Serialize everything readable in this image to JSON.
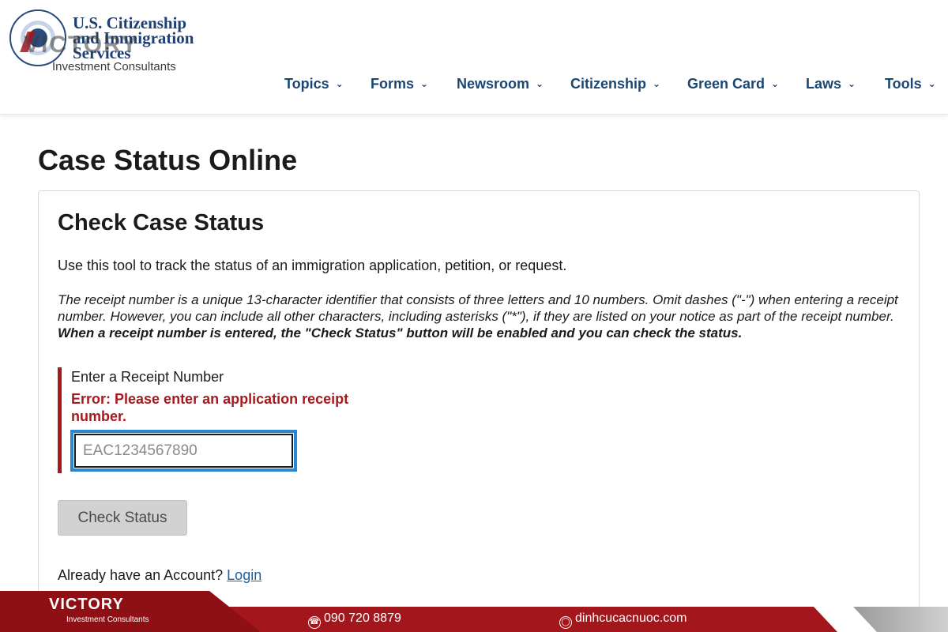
{
  "header": {
    "agency_name": "U.S. Citizenship and Immigration Services",
    "watermark_brand": "VICTORY",
    "watermark_sub": "Investment Consultants",
    "nav": [
      {
        "label": "Topics"
      },
      {
        "label": "Forms"
      },
      {
        "label": "Newsroom"
      },
      {
        "label": "Citizenship"
      },
      {
        "label": "Green Card"
      },
      {
        "label": "Laws"
      },
      {
        "label": "Tools"
      }
    ]
  },
  "page": {
    "title": "Case Status Online"
  },
  "card": {
    "title": "Check Case Status",
    "intro": "Use this tool to track the status of an immigration application, petition, or request.",
    "note_italic": "The receipt number is a unique 13-character identifier that consists of three letters and 10 numbers. Omit dashes (\"-\") when entering a receipt number. However, you can include all other characters, including asterisks (\"*\"), if they are listed on your notice as part of the receipt number.",
    "note_bold": "When a receipt number is entered, the \"Check Status\" button will be enabled and you can check the status.",
    "field_label": "Enter a Receipt Number",
    "field_error": "Error: Please enter an application receipt number.",
    "input_placeholder": "EAC1234567890",
    "button_label": "Check Status",
    "account_text": "Already have an Account?",
    "login_link": "Login"
  },
  "footer": {
    "brand": "VICTORY",
    "brand_sub": "Investment Consultants",
    "phone": "090 720 8879",
    "website": "dinhcucacnuoc.com"
  },
  "colors": {
    "nav_text": "#1c4672",
    "error_red": "#a61a1e",
    "input_focus": "#2a87d3",
    "footer_red": "#a3161c"
  }
}
